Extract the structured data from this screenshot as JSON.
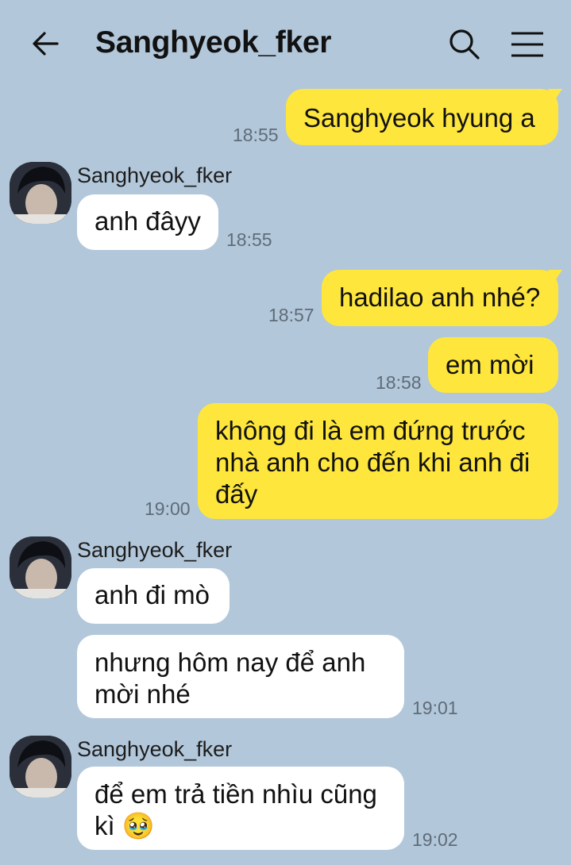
{
  "header": {
    "title": "Sanghyeok_fker"
  },
  "messages": [
    {
      "from": "me",
      "text": "Sanghyeok hyung a",
      "time": "18:55"
    },
    {
      "from": "them",
      "sender": "Sanghyeok_fker",
      "text": "anh đâyy",
      "time": "18:55"
    },
    {
      "from": "me",
      "text": "hadilao anh nhé?",
      "time": "18:57"
    },
    {
      "from": "me",
      "text": "em mời",
      "time": "18:58"
    },
    {
      "from": "me",
      "text": "không đi là em đứng trước\nnhà anh cho đến khi anh đi\nđấy",
      "time": "19:00"
    },
    {
      "from": "them",
      "sender": "Sanghyeok_fker",
      "text": "anh đi mò",
      "time": ""
    },
    {
      "from": "them",
      "text": "nhưng hôm nay để anh\nmời nhé",
      "time": "19:01"
    },
    {
      "from": "them",
      "sender": "Sanghyeok_fker",
      "text": "để em trả tiền nhìu cũng\nkì 🥹",
      "time": "19:02"
    }
  ],
  "colors": {
    "background": "#b2c7da",
    "outgoing_bubble": "#fee63c",
    "incoming_bubble": "#ffffff"
  },
  "icons": [
    "back-arrow-icon",
    "search-icon",
    "menu-icon",
    "avatar"
  ]
}
